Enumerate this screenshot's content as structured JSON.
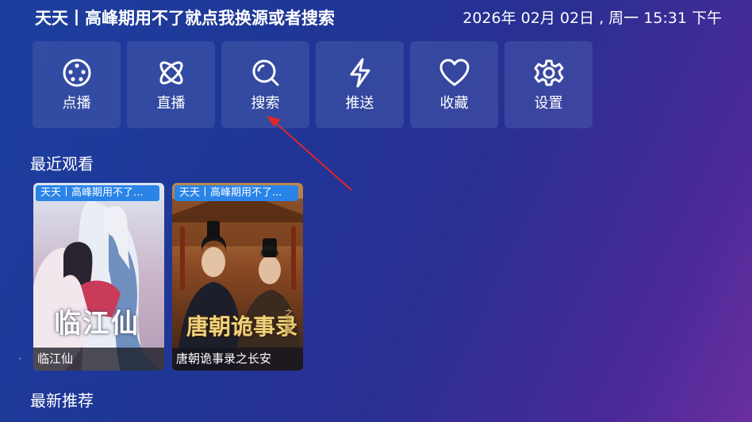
{
  "header": {
    "title": "天天丨高峰期用不了就点我换源或者搜索",
    "datetime": "2026年 02月 02日 , 周一 15:31 下午"
  },
  "menu": [
    {
      "label": "点播",
      "icon": "movie-reel-icon"
    },
    {
      "label": "直播",
      "icon": "atom-live-icon"
    },
    {
      "label": "搜索",
      "icon": "search-icon"
    },
    {
      "label": "推送",
      "icon": "lightning-icon"
    },
    {
      "label": "收藏",
      "icon": "heart-icon"
    },
    {
      "label": "设置",
      "icon": "gear-icon"
    }
  ],
  "sections": {
    "recent": "最近观看",
    "new": "最新推荐"
  },
  "recent": [
    {
      "source": "天天丨高峰期用不了...",
      "title": "临江仙",
      "poster_title": "临江仙"
    },
    {
      "source": "天天丨高峰期用不了...",
      "title": "唐朝诡事录之长安",
      "poster_title": "唐朝诡事录",
      "poster_subtitle": "之长安"
    }
  ],
  "colors": {
    "accent_tag": "#2a84e8",
    "annotation_arrow": "#e02828"
  }
}
